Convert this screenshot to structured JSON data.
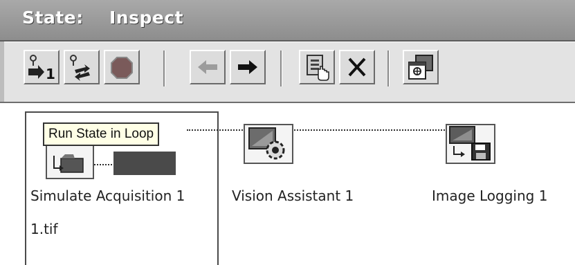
{
  "title": {
    "key": "State:",
    "value": "Inspect"
  },
  "toolbar": {
    "buttons": [
      {
        "name": "add-state-button",
        "icon": "probe-arrow-one-icon"
      },
      {
        "name": "loop-state-button",
        "icon": "probe-cycle-icon"
      },
      {
        "name": "stop-button",
        "icon": "stop-octagon-icon"
      },
      {
        "name": "move-left-button",
        "icon": "arrow-left-icon"
      },
      {
        "name": "move-right-button",
        "icon": "arrow-right-icon"
      },
      {
        "name": "insert-step-button",
        "icon": "clipboard-hand-icon"
      },
      {
        "name": "delete-button",
        "icon": "x-icon"
      },
      {
        "name": "overlay-button",
        "icon": "window-overlay-icon"
      }
    ]
  },
  "tooltip": "Run State in Loop",
  "steps": [
    {
      "label": "Simulate Acquisition 1",
      "detail": "1.tif"
    },
    {
      "label": "Vision Assistant 1"
    },
    {
      "label": "Image Logging 1"
    }
  ],
  "colors": {
    "titlebar": "#9a9a9a",
    "toolbar": "#e3e3e3",
    "tooltip_bg": "#ffffe6"
  }
}
